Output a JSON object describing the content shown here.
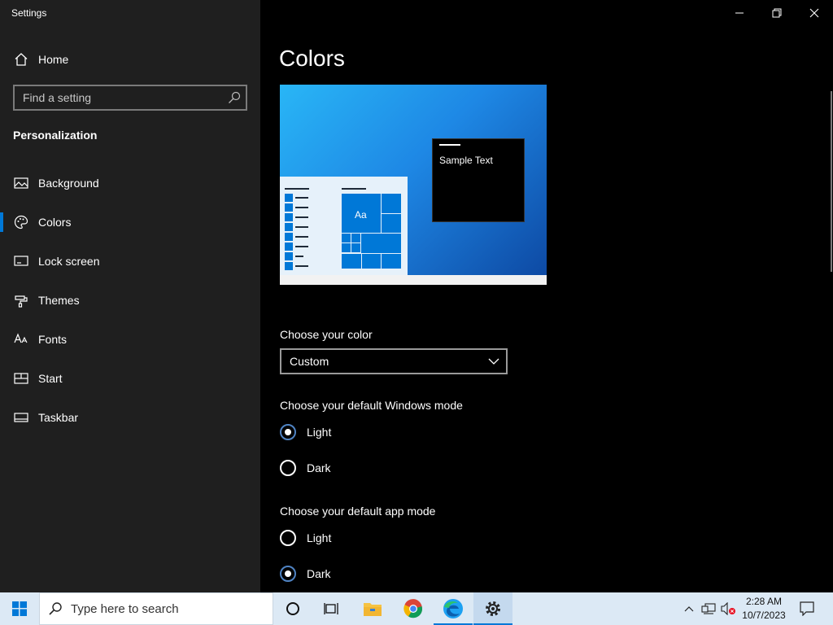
{
  "app": {
    "title": "Settings"
  },
  "sidebar": {
    "home_label": "Home",
    "search_placeholder": "Find a setting",
    "section_heading": "Personalization",
    "items": [
      {
        "label": "Background",
        "icon": "image-icon"
      },
      {
        "label": "Colors",
        "icon": "palette-icon",
        "active": true
      },
      {
        "label": "Lock screen",
        "icon": "lock-screen-icon"
      },
      {
        "label": "Themes",
        "icon": "brush-icon"
      },
      {
        "label": "Fonts",
        "icon": "fonts-icon"
      },
      {
        "label": "Start",
        "icon": "start-icon"
      },
      {
        "label": "Taskbar",
        "icon": "taskbar-icon"
      }
    ]
  },
  "main": {
    "page_title": "Colors",
    "preview": {
      "sample_text": "Sample Text",
      "tile_text": "Aa"
    },
    "choose_color": {
      "label": "Choose your color",
      "value": "Custom"
    },
    "windows_mode": {
      "label": "Choose your default Windows mode",
      "options": [
        {
          "label": "Light",
          "checked": true
        },
        {
          "label": "Dark",
          "checked": false
        }
      ]
    },
    "app_mode": {
      "label": "Choose your default app mode",
      "options": [
        {
          "label": "Light",
          "checked": false
        },
        {
          "label": "Dark",
          "checked": true
        }
      ]
    }
  },
  "taskbar": {
    "search_placeholder": "Type here to search",
    "time": "2:28 AM",
    "date": "10/7/2023",
    "apps": [
      "cortana-icon",
      "task-view-icon",
      "file-explorer-icon",
      "chrome-icon",
      "edge-icon",
      "settings-icon"
    ]
  },
  "colors": {
    "accent": "#0078d7",
    "sidebar_bg": "#1f1f1f",
    "main_bg": "#000000",
    "taskbar_bg": "#dce9f5"
  }
}
